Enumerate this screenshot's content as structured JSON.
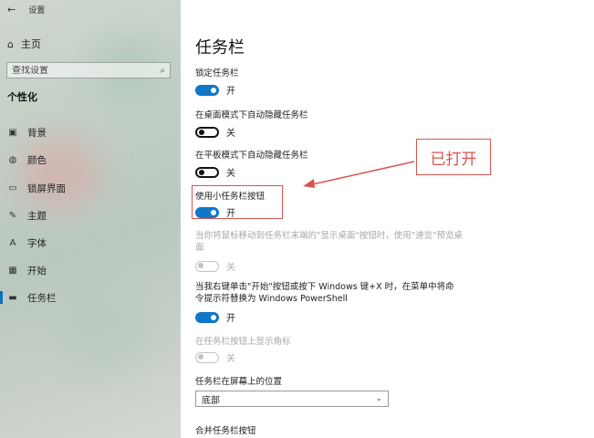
{
  "window": {
    "title": "设置",
    "back_glyph": "←"
  },
  "sidebar": {
    "home_label": "主页",
    "search_placeholder": "查找设置",
    "section_title": "个性化",
    "items": [
      {
        "label": "背景",
        "icon": "image-icon"
      },
      {
        "label": "颜色",
        "icon": "palette-icon"
      },
      {
        "label": "锁屏界面",
        "icon": "lockscreen-icon"
      },
      {
        "label": "主题",
        "icon": "brush-icon"
      },
      {
        "label": "字体",
        "icon": "font-icon"
      },
      {
        "label": "开始",
        "icon": "start-icon"
      },
      {
        "label": "任务栏",
        "icon": "taskbar-icon",
        "active": true
      }
    ]
  },
  "main": {
    "title": "任务栏",
    "settings": [
      {
        "label": "锁定任务栏",
        "state": "开",
        "on": true,
        "disabled": false
      },
      {
        "label": "在桌面模式下自动隐藏任务栏",
        "state": "关",
        "on": false,
        "disabled": false
      },
      {
        "label": "在平板模式下自动隐藏任务栏",
        "state": "关",
        "on": false,
        "disabled": false
      },
      {
        "label": "使用小任务栏按钮",
        "state": "开",
        "on": true,
        "disabled": false
      },
      {
        "label": "当你将鼠标移动到任务栏末端的\"显示桌面\"按钮时，使用\"速览\"预览桌面",
        "state": "关",
        "on": false,
        "disabled": true
      },
      {
        "label": "当我右键单击\"开始\"按钮或按下 Windows 键+X 时，在菜单中将命令提示符替换为 Windows PowerShell",
        "state": "开",
        "on": true,
        "disabled": false
      },
      {
        "label": "在任务栏按钮上显示角标",
        "state": "关",
        "on": false,
        "disabled": true
      }
    ],
    "position_label": "任务栏在屏幕上的位置",
    "position_value": "底部",
    "combine_label": "合并任务栏按钮"
  },
  "annotation": {
    "callout_text": "已打开",
    "color": "#d9534f"
  },
  "colors": {
    "accent": "#0f77c8"
  }
}
